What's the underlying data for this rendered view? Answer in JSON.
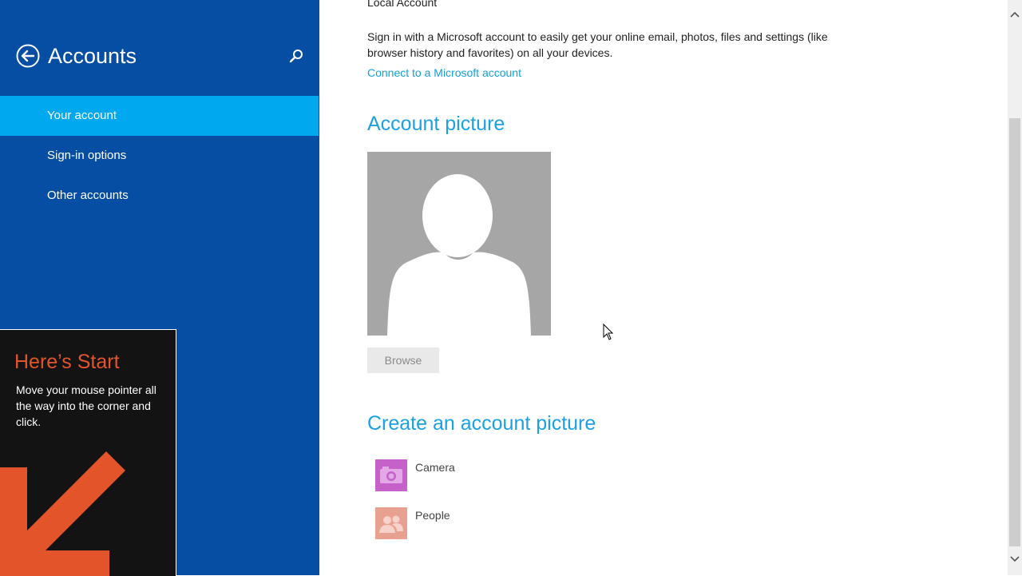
{
  "sidebar": {
    "title": "Accounts",
    "items": [
      {
        "label": "Your account",
        "active": true
      },
      {
        "label": "Sign-in options",
        "active": false
      },
      {
        "label": "Other accounts",
        "active": false
      }
    ],
    "icons": {
      "back": "back-arrow-circle-icon",
      "search": "search-icon"
    }
  },
  "start_tip": {
    "title": "Here’s Start",
    "text": "Move your mouse pointer all the way into the corner and click.",
    "icon": "corner-arrow-icon"
  },
  "main": {
    "account_type": "Local Account",
    "description": "Sign in with a Microsoft account to easily get your online email, photos, files and settings (like browser history and favorites) on all your devices.",
    "connect_link": "Connect to a Microsoft account",
    "account_picture_heading": "Account picture",
    "browse_label": "Browse",
    "create_heading": "Create an account picture",
    "apps": [
      {
        "label": "Camera",
        "icon": "camera-icon",
        "color": "#c561c9"
      },
      {
        "label": "People",
        "icon": "people-icon",
        "color": "#e8a090"
      }
    ]
  },
  "colors": {
    "sidebar_bg": "#064ea3",
    "active_item": "#00a8f0",
    "accent": "#1ba1e2",
    "tip_title": "#e4542a"
  }
}
